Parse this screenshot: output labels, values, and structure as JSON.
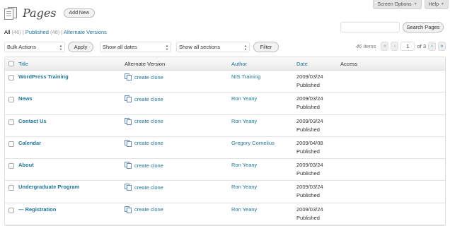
{
  "screen_meta": {
    "screen_options": "Screen Options",
    "help": "Help"
  },
  "header": {
    "title": "Pages",
    "add_new": "Add New"
  },
  "filters": {
    "all": "All",
    "all_count": "(46)",
    "published": "Published",
    "published_count": "(46)",
    "alternate": "Alternate Versions"
  },
  "search": {
    "placeholder": "",
    "button": "Search Pages"
  },
  "tablenav": {
    "bulk_actions": "Bulk Actions",
    "apply": "Apply",
    "dates": "Show all dates",
    "sections": "Show all sections",
    "filter": "Filter"
  },
  "pager": {
    "items": "46 items",
    "first": "«",
    "prev": "‹",
    "current": "1",
    "of_text": "of 3",
    "next": "›",
    "last": "»"
  },
  "columns": {
    "title": "Title",
    "alternate": "Alternate Version",
    "author": "Author",
    "date": "Date",
    "access": "Access"
  },
  "rows": [
    {
      "title": "WordPress Training",
      "alt": "create clone",
      "author": "NIS Training",
      "date": "2009/03/24",
      "status": "Published"
    },
    {
      "title": "News",
      "alt": "create clone",
      "author": "Ron Yeany",
      "date": "2009/03/24",
      "status": "Published"
    },
    {
      "title": "Contact Us",
      "alt": "create clone",
      "author": "Ron Yeany",
      "date": "2009/03/24",
      "status": "Published"
    },
    {
      "title": "Calendar",
      "alt": "create clone",
      "author": "Gregory Cornelius",
      "date": "2009/04/08",
      "status": "Published"
    },
    {
      "title": "About",
      "alt": "create clone",
      "author": "Ron Yeany",
      "date": "2009/03/24",
      "status": "Published"
    },
    {
      "title": "Undergraduate Program",
      "alt": "create clone",
      "author": "Ron Yeany",
      "date": "2009/03/24",
      "status": "Published"
    },
    {
      "title": "— Registration",
      "alt": "create clone",
      "author": "Ron Yeany",
      "date": "2009/03/24",
      "status": "Published"
    }
  ],
  "colors": {
    "link": "#21759b",
    "border": "#dfdfdf"
  }
}
